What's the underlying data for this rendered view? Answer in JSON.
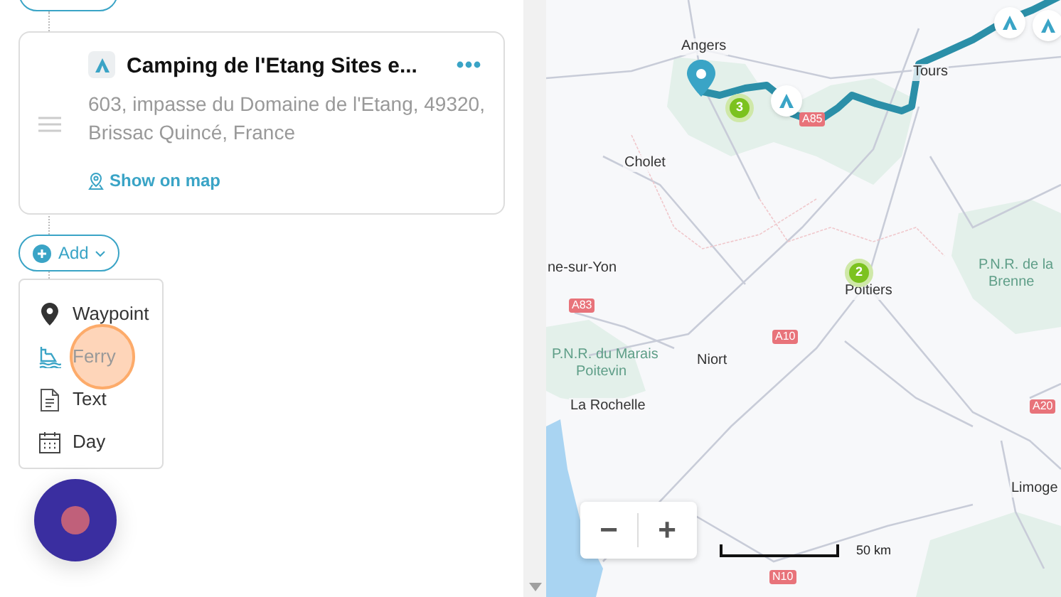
{
  "stop": {
    "title": "Camping de l'Etang Sites e...",
    "address": "603, impasse du Domaine de l'Etang, 49320, Brissac Quincé, France",
    "link": "Show on map"
  },
  "add_button": {
    "label": "Add",
    "expanded": true
  },
  "add_menu": [
    {
      "kind": "waypoint",
      "label": "Waypoint",
      "clicked": false
    },
    {
      "kind": "ferry",
      "label": "Ferry",
      "clicked": true
    },
    {
      "kind": "text",
      "label": "Text",
      "clicked": false
    },
    {
      "kind": "day",
      "label": "Day",
      "clicked": false
    }
  ],
  "map": {
    "labels": [
      {
        "kind": "city",
        "text": "Angers"
      },
      {
        "kind": "city",
        "text": "Tours"
      },
      {
        "kind": "city",
        "text": "Cholet"
      },
      {
        "kind": "city",
        "text": "ne-sur-Yon"
      },
      {
        "kind": "city",
        "text": "Poitiers"
      },
      {
        "kind": "park",
        "text": "P.N.R. de la"
      },
      {
        "kind": "park",
        "text": "Brenne"
      },
      {
        "kind": "road",
        "text": "A83"
      },
      {
        "kind": "road",
        "text": "A85"
      },
      {
        "kind": "road",
        "text": "A10"
      },
      {
        "kind": "road",
        "text": "A20"
      },
      {
        "kind": "road",
        "text": "N10"
      },
      {
        "kind": "park",
        "text": "P.N.R. du Marais"
      },
      {
        "kind": "park",
        "text": "Poitevin"
      },
      {
        "kind": "city",
        "text": "Niort"
      },
      {
        "kind": "city",
        "text": "La Rochelle"
      },
      {
        "kind": "city",
        "text": "Limoge"
      }
    ],
    "clusters": [
      "3",
      "2"
    ],
    "zoom_out": "−",
    "zoom_in": "+",
    "scale": "50 km"
  }
}
